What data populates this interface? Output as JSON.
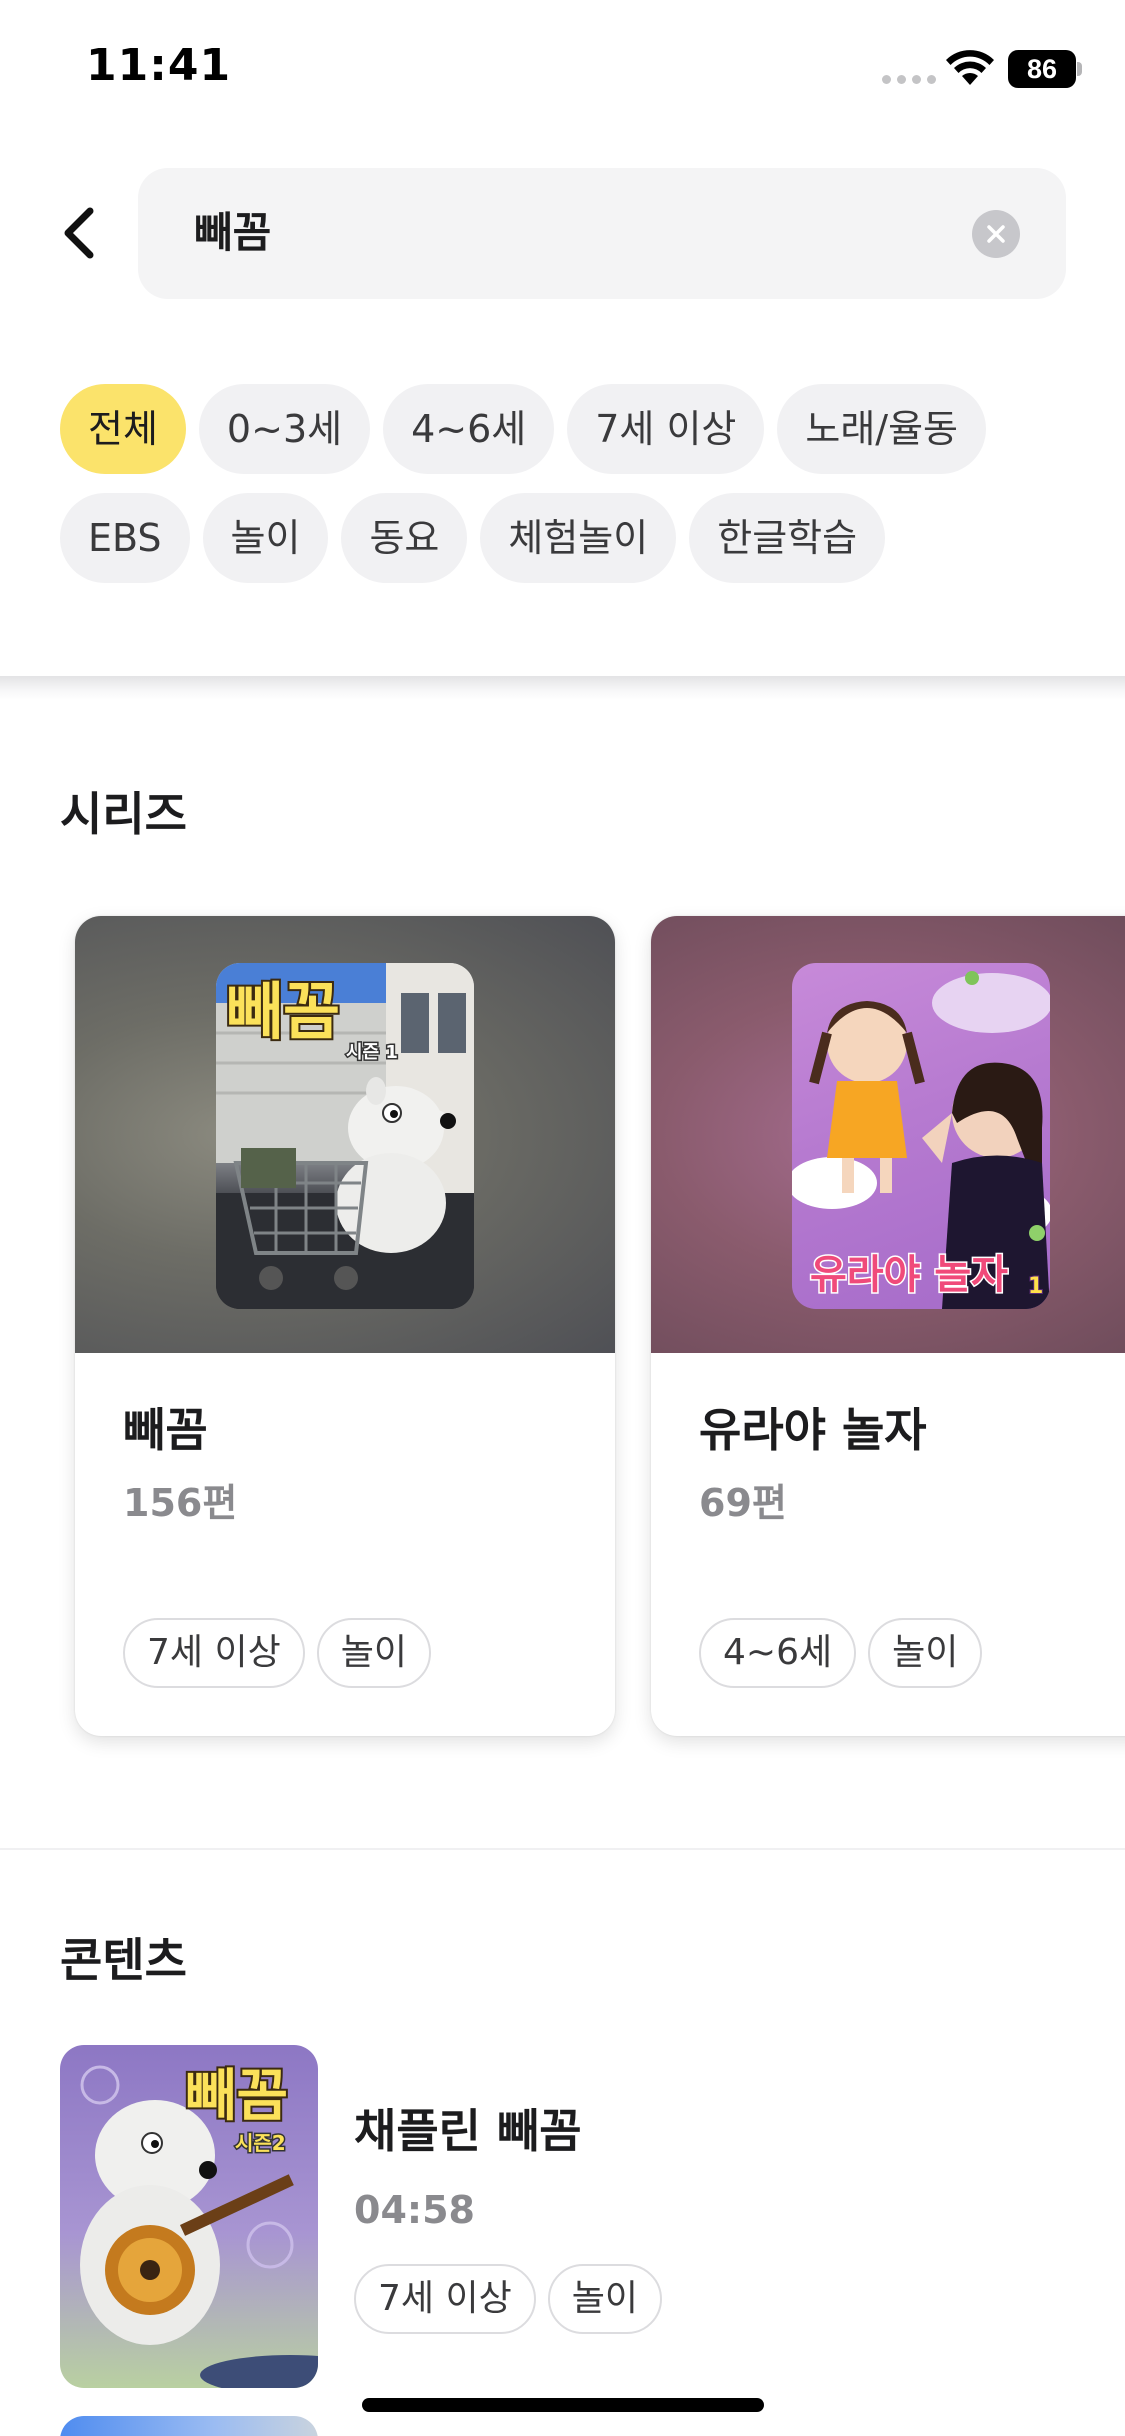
{
  "status_bar": {
    "time": "11:41",
    "battery": "86"
  },
  "search": {
    "query": "빼꼼",
    "back_icon": "chevron-left-icon",
    "clear_icon": "clear-circle-icon"
  },
  "filters": {
    "row1": [
      "전체",
      "0~3세",
      "4~6세",
      "7세 이상",
      "노래/율동"
    ],
    "row2": [
      "EBS",
      "놀이",
      "동요",
      "체험놀이",
      "한글학습"
    ],
    "selected": "전체",
    "accent_color": "#fbe36b"
  },
  "series": {
    "title": "시리즈",
    "cards": [
      {
        "title": "빼꼼",
        "count": "156편",
        "tags": [
          "7세 이상",
          "놀이"
        ],
        "poster_logo": "빼꼼",
        "poster_badge": "시즌 1"
      },
      {
        "title": "유라야 놀자",
        "count": "69편",
        "tags": [
          "4~6세",
          "놀이"
        ],
        "poster_logo": "유라야 놀자",
        "poster_badge": "1"
      }
    ]
  },
  "contents": {
    "title": "콘텐츠",
    "items": [
      {
        "title": "채플린 빼꼼",
        "duration": "04:58",
        "tags": [
          "7세 이상",
          "놀이"
        ],
        "poster_logo": "빼꼼",
        "poster_badge": "시즌2"
      }
    ]
  }
}
